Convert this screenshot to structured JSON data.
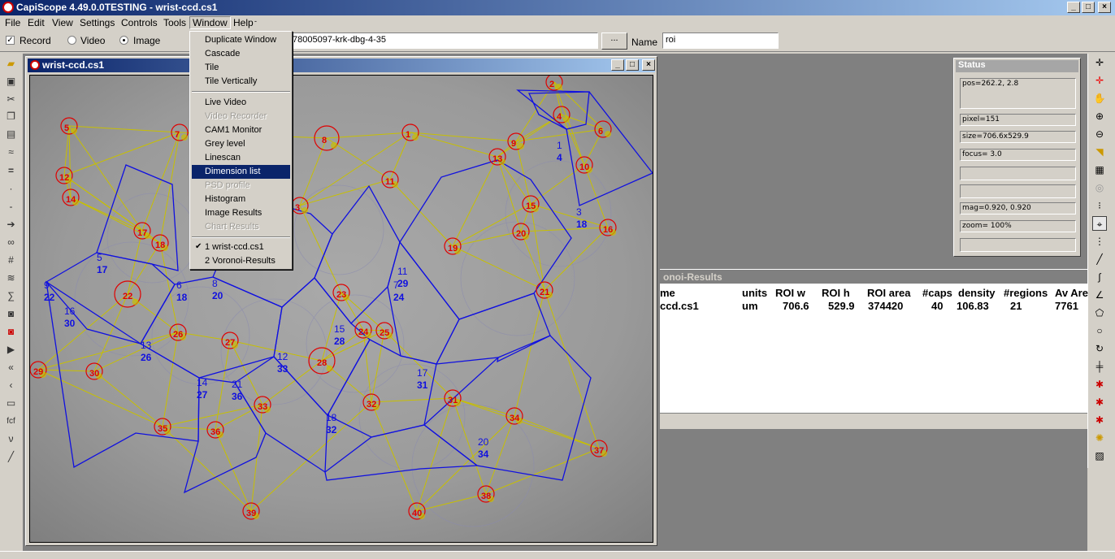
{
  "app": {
    "title": "CapiScope 4.49.0.0TESTING - wrist-ccd.cs1"
  },
  "menubar": [
    "File",
    "Edit",
    "View",
    "Settings",
    "Controls",
    "Tools",
    "Window",
    "Help"
  ],
  "toolbar": {
    "record_label": "Record",
    "record_checked": true,
    "video_label": "Video",
    "image_label": "Image",
    "mode_selected": "Image",
    "path_value": "78005097-krk-dbg-4-35",
    "browse_label": "...",
    "name_label": "Name",
    "name_value": "roi"
  },
  "window_menu": {
    "items": [
      {
        "label": "Duplicate Window",
        "enabled": true
      },
      {
        "label": "Cascade",
        "enabled": true
      },
      {
        "label": "Tile",
        "enabled": true
      },
      {
        "label": "Tile Vertically",
        "enabled": true
      },
      {
        "label": "Live Video",
        "enabled": true
      },
      {
        "label": "Video Recorder",
        "enabled": false
      },
      {
        "label": "CAM1 Monitor",
        "enabled": true
      },
      {
        "label": "Grey level",
        "enabled": true
      },
      {
        "label": "Linescan",
        "enabled": true
      },
      {
        "label": "Dimension list",
        "enabled": true,
        "selected": true
      },
      {
        "label": "PSD profile",
        "enabled": false
      },
      {
        "label": "Histogram",
        "enabled": true
      },
      {
        "label": "Image Results",
        "enabled": true
      },
      {
        "label": "Chart Results",
        "enabled": false
      },
      {
        "label": "1 wrist-ccd.cs1",
        "enabled": true,
        "checked": true
      },
      {
        "label": "2 Voronoi-Results",
        "enabled": true
      }
    ]
  },
  "image_window": {
    "title": "wrist-ccd.cs1",
    "red_labels": [
      "1",
      "2",
      "3",
      "4",
      "5",
      "6",
      "7",
      "8",
      "9",
      "10",
      "11",
      "12",
      "13",
      "14",
      "15",
      "16",
      "17",
      "18",
      "19",
      "20",
      "21",
      "22",
      "23",
      "24",
      "25",
      "26",
      "27",
      "28",
      "29",
      "30",
      "31",
      "32",
      "33",
      "34",
      "35",
      "36",
      "37",
      "38",
      "39",
      "40"
    ],
    "blue_pairs": [
      [
        "5",
        "17"
      ],
      [
        "6",
        "18"
      ],
      [
        "8",
        "20"
      ],
      [
        "9",
        "22"
      ],
      [
        "16",
        "30"
      ],
      [
        "13",
        "26"
      ],
      [
        "14",
        "27"
      ],
      [
        "21",
        "36"
      ],
      [
        "12",
        "33"
      ],
      [
        "15",
        "28"
      ],
      [
        "18",
        "32"
      ],
      [
        "17",
        "31"
      ],
      [
        "20",
        "34"
      ],
      [
        "11",
        "29"
      ],
      [
        "7",
        "24"
      ],
      [
        "1",
        "4"
      ],
      [
        "3",
        "18"
      ]
    ]
  },
  "status_panel": {
    "title": "Status",
    "pos": "pos=262.2,  2.8",
    "pixel": "pixel=151",
    "size": "size=706.6x529.9",
    "focus": "focus=  3.0",
    "mag": "mag=0.920, 0.920",
    "zoom": "zoom= 100%"
  },
  "results_window": {
    "title": "onoi-Results",
    "columns": [
      "me",
      "units",
      "ROI w",
      "ROI h",
      "ROI area",
      "#caps",
      "density",
      "#regions",
      "Av Are"
    ],
    "rows": [
      [
        "ccd.cs1",
        "um",
        "706.6",
        "529.9",
        "374420",
        "40",
        "106.83",
        "21",
        "7761"
      ]
    ]
  },
  "colors": {
    "title_start": "#0a246a",
    "title_end": "#a6caf0",
    "capillary_red": "#e00000",
    "voronoi_blue": "#1010e0",
    "delaunay_yellow": "#c8c000"
  }
}
